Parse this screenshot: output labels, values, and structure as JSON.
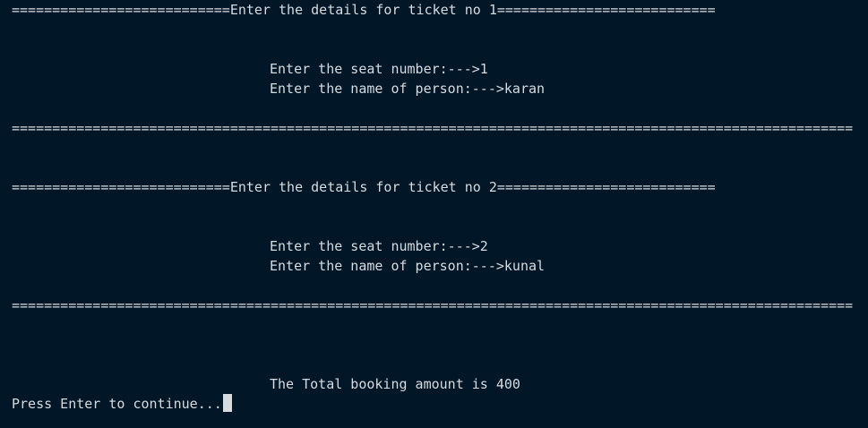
{
  "terminal": {
    "ticket1": {
      "header": "===========================Enter the details for ticket no 1===========================",
      "seat_prompt": "Enter the seat number:--->1",
      "name_prompt": "Enter the name of person:--->karan",
      "separator": "========================================================================================================"
    },
    "ticket2": {
      "header": "===========================Enter the details for ticket no 2===========================",
      "seat_prompt": "Enter the seat number:--->2",
      "name_prompt": "Enter the name of person:--->kunal",
      "separator": "========================================================================================================"
    },
    "total_line": "The Total booking amount is 400",
    "continue_prompt": "Press Enter to continue...",
    "colors": {
      "background": "#011627",
      "text": "#d6dbe0"
    }
  }
}
